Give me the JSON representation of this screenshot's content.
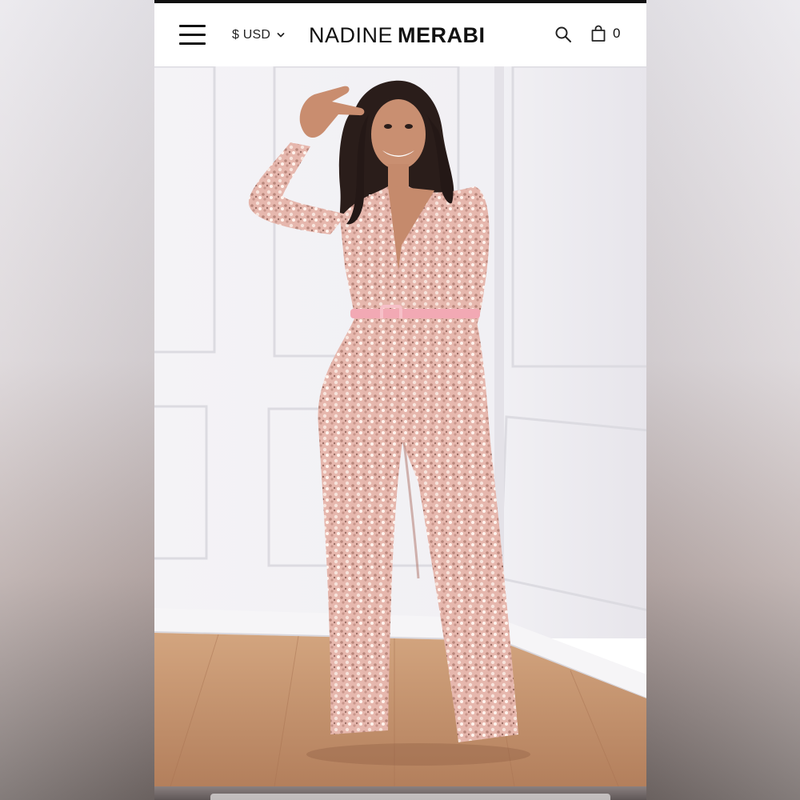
{
  "header": {
    "currency_label": "$ USD",
    "logo_first": "NADINE",
    "logo_second": "MERABI",
    "cart_count": "0"
  },
  "icons": {
    "menu": "hamburger-menu-icon",
    "currency_toggle": "chevron-down-icon",
    "search": "search-icon",
    "cart": "shopping-bag-icon"
  },
  "hero": {
    "alt": "Model wearing a pink sequin long-sleeve V-neck jumpsuit with belt"
  },
  "colors": {
    "top_bar": "#111111",
    "nav_background": "#ffffff",
    "sequin_pink": "#e3b2a8",
    "wall": "#f3f2f5",
    "floor": "#c08d68"
  }
}
